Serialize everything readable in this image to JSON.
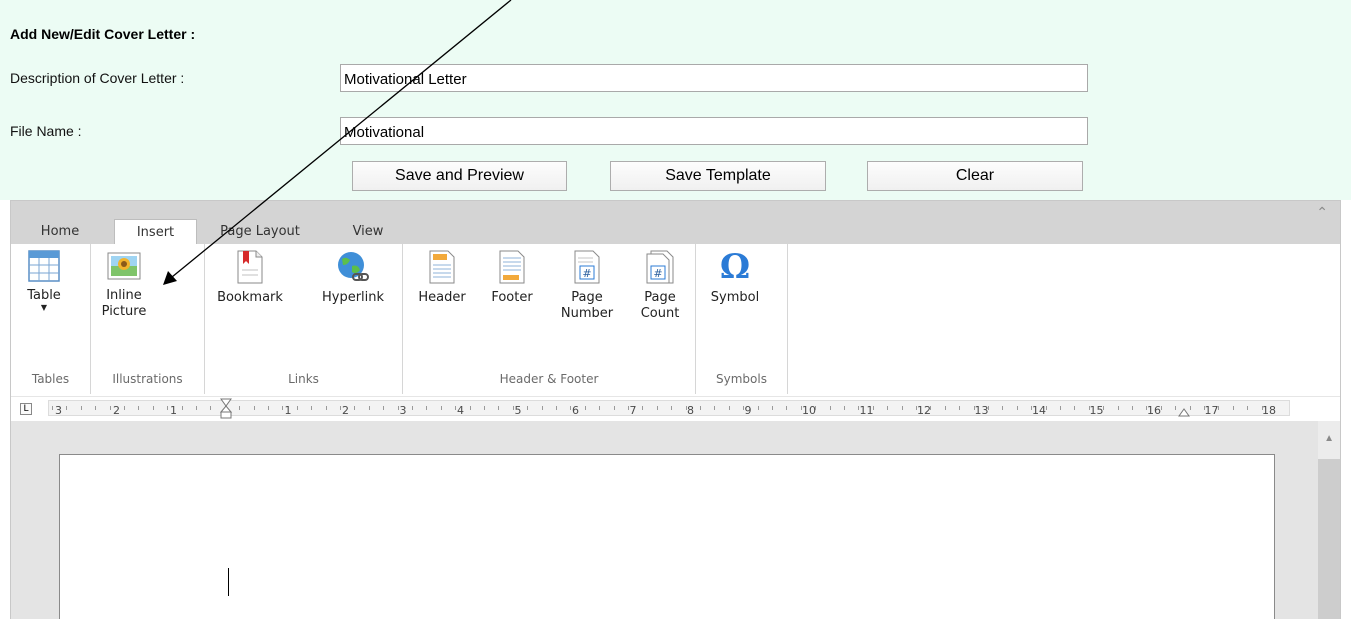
{
  "form": {
    "title": "Add New/Edit Cover Letter :",
    "description_label": "Description of Cover Letter :",
    "description_value": "Motivational Letter",
    "file_name_label": "File Name :",
    "file_name_value": "Motivational",
    "buttons": {
      "save_preview": "Save and Preview",
      "save_template": "Save Template",
      "clear": "Clear"
    }
  },
  "editor": {
    "tabs": [
      "Home",
      "Insert",
      "Page Layout",
      "View"
    ],
    "active_tab": "Insert",
    "collapse_icon": "chevron-up-icon",
    "ribbon": {
      "groups": {
        "tables": "Tables",
        "illustrations": "Illustrations",
        "links": "Links",
        "header_footer": "Header & Footer",
        "symbols": "Symbols"
      },
      "buttons": {
        "table": "Table",
        "inline_picture_1": "Inline",
        "inline_picture_2": "Picture",
        "bookmark": "Bookmark",
        "hyperlink": "Hyperlink",
        "header": "Header",
        "footer": "Footer",
        "page_number_1": "Page",
        "page_number_2": "Number",
        "page_count_1": "Page",
        "page_count_2": "Count",
        "symbol": "Symbol",
        "symbol_glyph": "Ω"
      }
    },
    "ruler": {
      "tab_selector": "L",
      "left_numbers": [
        "3",
        "2",
        "1"
      ],
      "right_numbers": [
        "1",
        "2",
        "3",
        "4",
        "5",
        "6",
        "7",
        "8",
        "9",
        "10",
        "11",
        "12",
        "13",
        "14",
        "15",
        "16",
        "17",
        "18"
      ]
    }
  },
  "colors": {
    "form_background": "#ecfcf4",
    "tab_strip": "#d4d4d4",
    "accent_blue": "#2b7bd6"
  }
}
